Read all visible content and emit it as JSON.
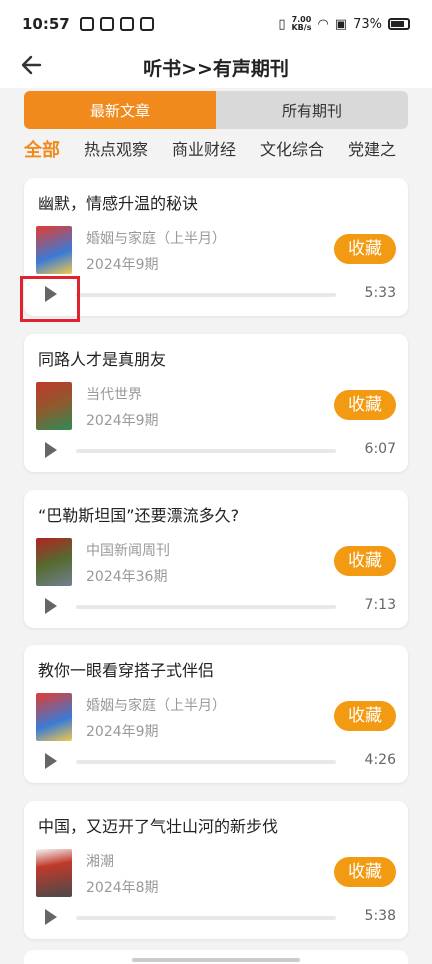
{
  "status_bar": {
    "time": "10:57",
    "net_top": "7.00",
    "net_bottom": "KB/s",
    "battery": "73%"
  },
  "header": {
    "title": "听书>>有声期刊"
  },
  "segments": [
    {
      "label": "最新文章",
      "active": true
    },
    {
      "label": "所有期刊",
      "active": false
    }
  ],
  "categories": [
    "全部",
    "热点观察",
    "商业财经",
    "文化综合",
    "党建之"
  ],
  "articles": [
    {
      "title": "幽默，情感升温的秘诀",
      "magazine": "婚姻与家庭（上半月）",
      "issue": "2024年9期",
      "duration": "5:33",
      "fav": "收藏"
    },
    {
      "title": "同路人才是真朋友",
      "magazine": "当代世界",
      "issue": "2024年9期",
      "duration": "6:07",
      "fav": "收藏"
    },
    {
      "title": "“巴勒斯坦国”还要漂流多久?",
      "magazine": "中国新闻周刊",
      "issue": "2024年36期",
      "duration": "7:13",
      "fav": "收藏"
    },
    {
      "title": "教你一眼看穿搭子式伴侣",
      "magazine": "婚姻与家庭（上半月）",
      "issue": "2024年9期",
      "duration": "4:26",
      "fav": "收藏"
    },
    {
      "title": "中国，又迈开了气壮山河的新步伐",
      "magazine": "湘潮",
      "issue": "2024年8期",
      "duration": "5:38",
      "fav": "收藏"
    }
  ],
  "colors": {
    "accent": "#f08a1c",
    "fav": "#f29a12"
  }
}
